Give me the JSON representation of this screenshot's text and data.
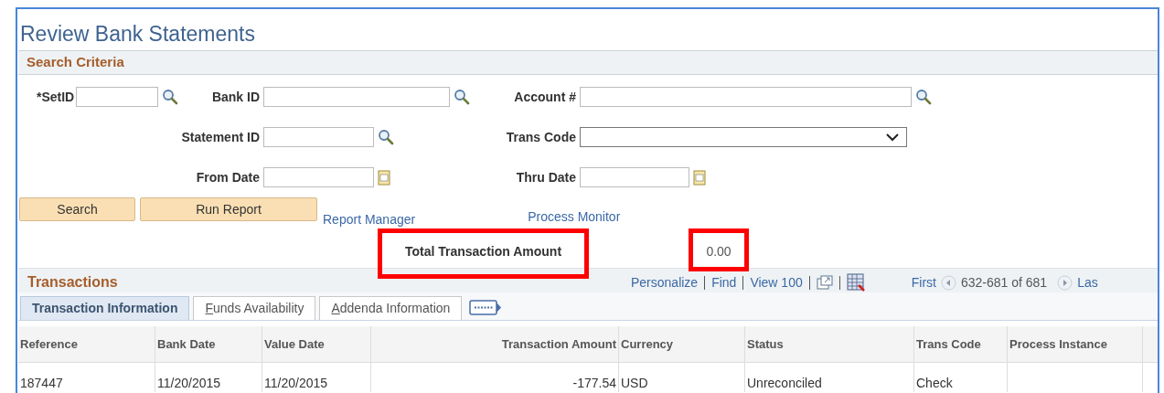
{
  "page_title": "Review Bank Statements",
  "search_criteria": {
    "title": "Search Criteria",
    "rows": [
      [
        {
          "label": "*SetID",
          "kind": "lookup"
        },
        {
          "label": "Bank ID",
          "kind": "lookup"
        },
        {
          "label": "Account #",
          "kind": "lookup"
        }
      ],
      [
        "",
        {
          "label": "Statement ID",
          "kind": "lookup"
        },
        {
          "label": "Trans Code",
          "kind": "select"
        }
      ],
      [
        "",
        {
          "label": "From Date",
          "kind": "date"
        },
        {
          "label": "Thru Date",
          "kind": "date"
        }
      ]
    ]
  },
  "buttons": [
    "Search",
    "Run Report"
  ],
  "links": [
    "Report Manager",
    "Process Monitor"
  ],
  "total": {
    "label": "Total Transaction Amount",
    "value": "0.00",
    "label_highlighted": true,
    "value_highlighted": true
  },
  "transactions": {
    "title": "Transactions",
    "toolbar": {
      "links": [
        "Personalize",
        "Find",
        "View 100"
      ],
      "first": "First",
      "range": "632-681 of 681",
      "last": "Las"
    },
    "tabs": [
      {
        "label": "Transaction Information",
        "selected": true,
        "access_key": false
      },
      {
        "label": "Funds Availability",
        "selected": false,
        "access_key": true
      },
      {
        "label": "Addenda Information",
        "selected": false,
        "access_key": true
      }
    ],
    "columns": [
      "Reference",
      "Bank Date",
      "Value Date",
      "Transaction Amount",
      "Currency",
      "Status",
      "Trans Code",
      "Process Instance"
    ],
    "rows": [
      [
        "187447",
        "11/20/2015",
        "11/20/2015",
        "-177.54",
        "USD",
        "Unreconciled",
        "Check"
      ]
    ]
  }
}
